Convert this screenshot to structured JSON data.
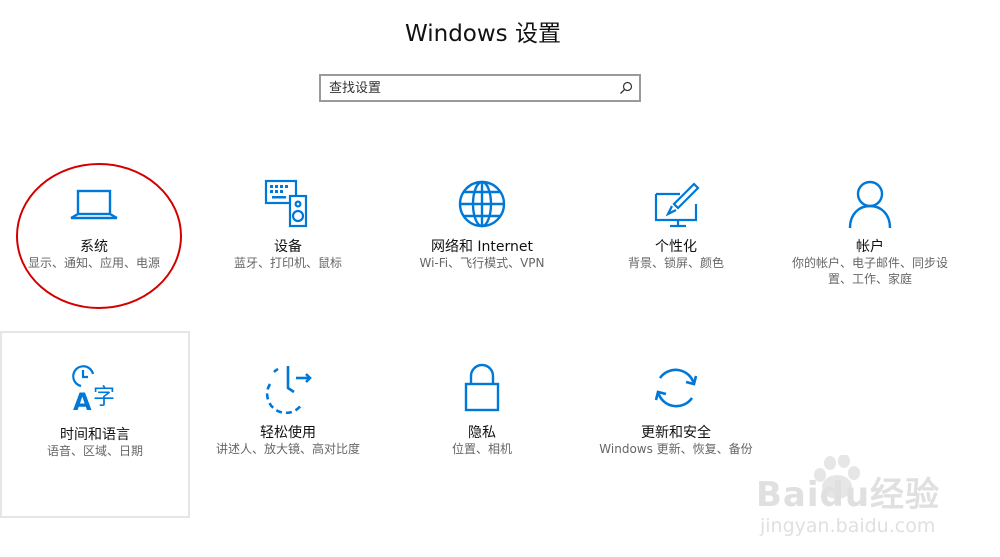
{
  "window": {
    "title": "Windows 设置"
  },
  "search": {
    "placeholder": "查找设置"
  },
  "tiles": [
    {
      "label": "系统",
      "desc": "显示、通知、应用、电源",
      "icon": "laptop-icon"
    },
    {
      "label": "设备",
      "desc": "蓝牙、打印机、鼠标",
      "icon": "devices-icon"
    },
    {
      "label": "网络和 Internet",
      "desc": "Wi-Fi、飞行模式、VPN",
      "icon": "globe-icon"
    },
    {
      "label": "个性化",
      "desc": "背景、锁屏、颜色",
      "icon": "personalization-icon"
    },
    {
      "label": "帐户",
      "desc": "你的帐户、电子邮件、同步设置、工作、家庭",
      "icon": "person-icon"
    },
    {
      "label": "时间和语言",
      "desc": "语音、区域、日期",
      "icon": "time-language-icon"
    },
    {
      "label": "轻松使用",
      "desc": "讲述人、放大镜、高对比度",
      "icon": "ease-of-access-icon"
    },
    {
      "label": "隐私",
      "desc": "位置、相机",
      "icon": "lock-icon"
    },
    {
      "label": "更新和安全",
      "desc": "Windows 更新、恢复、备份",
      "icon": "sync-icon"
    }
  ],
  "colors": {
    "accent": "#0078d7",
    "annotation": "#d40000"
  },
  "watermark": {
    "brand": "Baidu经验",
    "url": "jingyan.baidu.com"
  }
}
